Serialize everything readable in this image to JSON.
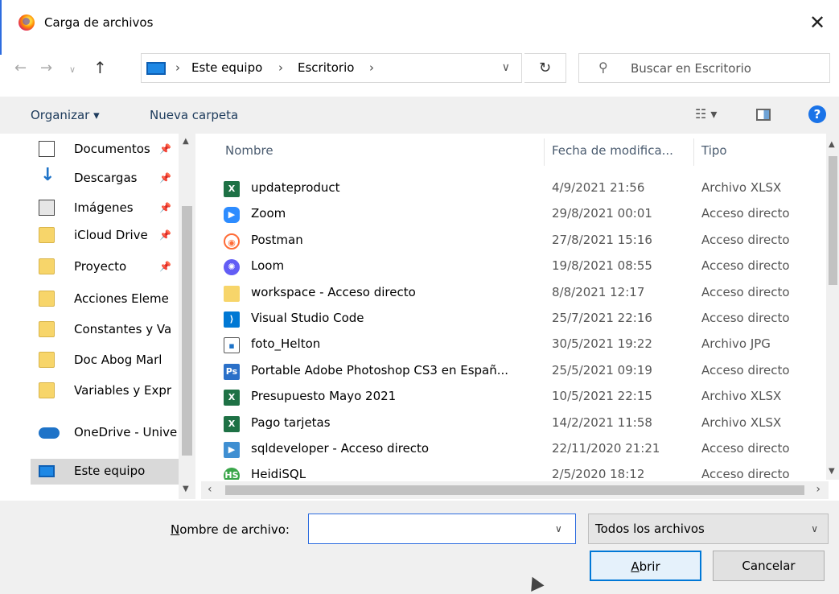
{
  "window": {
    "title": "Carga de archivos"
  },
  "address": {
    "crumbs": [
      "Este equipo",
      "Escritorio"
    ],
    "search_placeholder": "Buscar en Escritorio"
  },
  "toolbar": {
    "organize_label": "Organizar ▾",
    "new_folder_label": "Nueva carpeta"
  },
  "nav": {
    "items": [
      {
        "label": "Documentos",
        "icon": "document-icon",
        "pinned": true
      },
      {
        "label": "Descargas",
        "icon": "download-icon",
        "pinned": true
      },
      {
        "label": "Imágenes",
        "icon": "images-icon",
        "pinned": true
      },
      {
        "label": "iCloud Drive",
        "icon": "folder-icon",
        "pinned": true
      },
      {
        "label": "Proyecto",
        "icon": "folder-icon",
        "pinned": true
      },
      {
        "label": "Acciones Eleme",
        "icon": "folder-icon",
        "pinned": false
      },
      {
        "label": "Constantes y Va",
        "icon": "folder-icon",
        "pinned": false
      },
      {
        "label": "Doc Abog Marl",
        "icon": "folder-icon",
        "pinned": false
      },
      {
        "label": "Variables y Expr",
        "icon": "folder-icon",
        "pinned": false
      },
      {
        "label": "OneDrive - Unive",
        "icon": "cloud-icon",
        "pinned": false
      },
      {
        "label": "Este equipo",
        "icon": "computer-icon",
        "pinned": false,
        "selected": true
      }
    ]
  },
  "columns": {
    "name": "Nombre",
    "date": "Fecha de modifica...",
    "type": "Tipo"
  },
  "files": [
    {
      "name": "updateproduct",
      "date": "4/9/2021 21:56",
      "type": "Archivo XLSX",
      "icon": "excel-icon",
      "glyph": "X"
    },
    {
      "name": "Zoom",
      "date": "29/8/2021 00:01",
      "type": "Acceso directo",
      "icon": "zoom-icon",
      "glyph": "▶"
    },
    {
      "name": "Postman",
      "date": "27/8/2021 15:16",
      "type": "Acceso directo",
      "icon": "postman-icon",
      "glyph": "◉"
    },
    {
      "name": "Loom",
      "date": "19/8/2021 08:55",
      "type": "Acceso directo",
      "icon": "loom-icon",
      "glyph": "✺"
    },
    {
      "name": "workspace - Acceso directo",
      "date": "8/8/2021 12:17",
      "type": "Acceso directo",
      "icon": "folder-shortcut-icon",
      "glyph": ""
    },
    {
      "name": "Visual Studio Code",
      "date": "25/7/2021 22:16",
      "type": "Acceso directo",
      "icon": "vscode-icon",
      "glyph": "⟩"
    },
    {
      "name": "foto_Helton",
      "date": "30/5/2021 19:22",
      "type": "Archivo JPG",
      "icon": "image-file-icon",
      "glyph": "▪"
    },
    {
      "name": "Portable Adobe Photoshop CS3 en Españ...",
      "date": "25/5/2021 09:19",
      "type": "Acceso directo",
      "icon": "photoshop-icon",
      "glyph": "Ps"
    },
    {
      "name": "Presupuesto Mayo 2021",
      "date": "10/5/2021 22:15",
      "type": "Archivo XLSX",
      "icon": "excel-icon",
      "glyph": "X"
    },
    {
      "name": "Pago tarjetas",
      "date": "14/2/2021 11:58",
      "type": "Archivo XLSX",
      "icon": "excel-icon",
      "glyph": "X"
    },
    {
      "name": "sqldeveloper - Acceso directo",
      "date": "22/11/2020 21:21",
      "type": "Acceso directo",
      "icon": "sqldeveloper-icon",
      "glyph": "▶"
    },
    {
      "name": "HeidiSQL",
      "date": "2/5/2020 18:12",
      "type": "Acceso directo",
      "icon": "heidisql-icon",
      "glyph": "HS"
    }
  ],
  "bottom": {
    "filename_label_underlined": "N",
    "filename_label_rest": "ombre de archivo:",
    "filename_value": "",
    "filter_value": "Todos los archivos",
    "open_label_underlined": "A",
    "open_label_rest": "brir",
    "cancel_label": "Cancelar"
  }
}
